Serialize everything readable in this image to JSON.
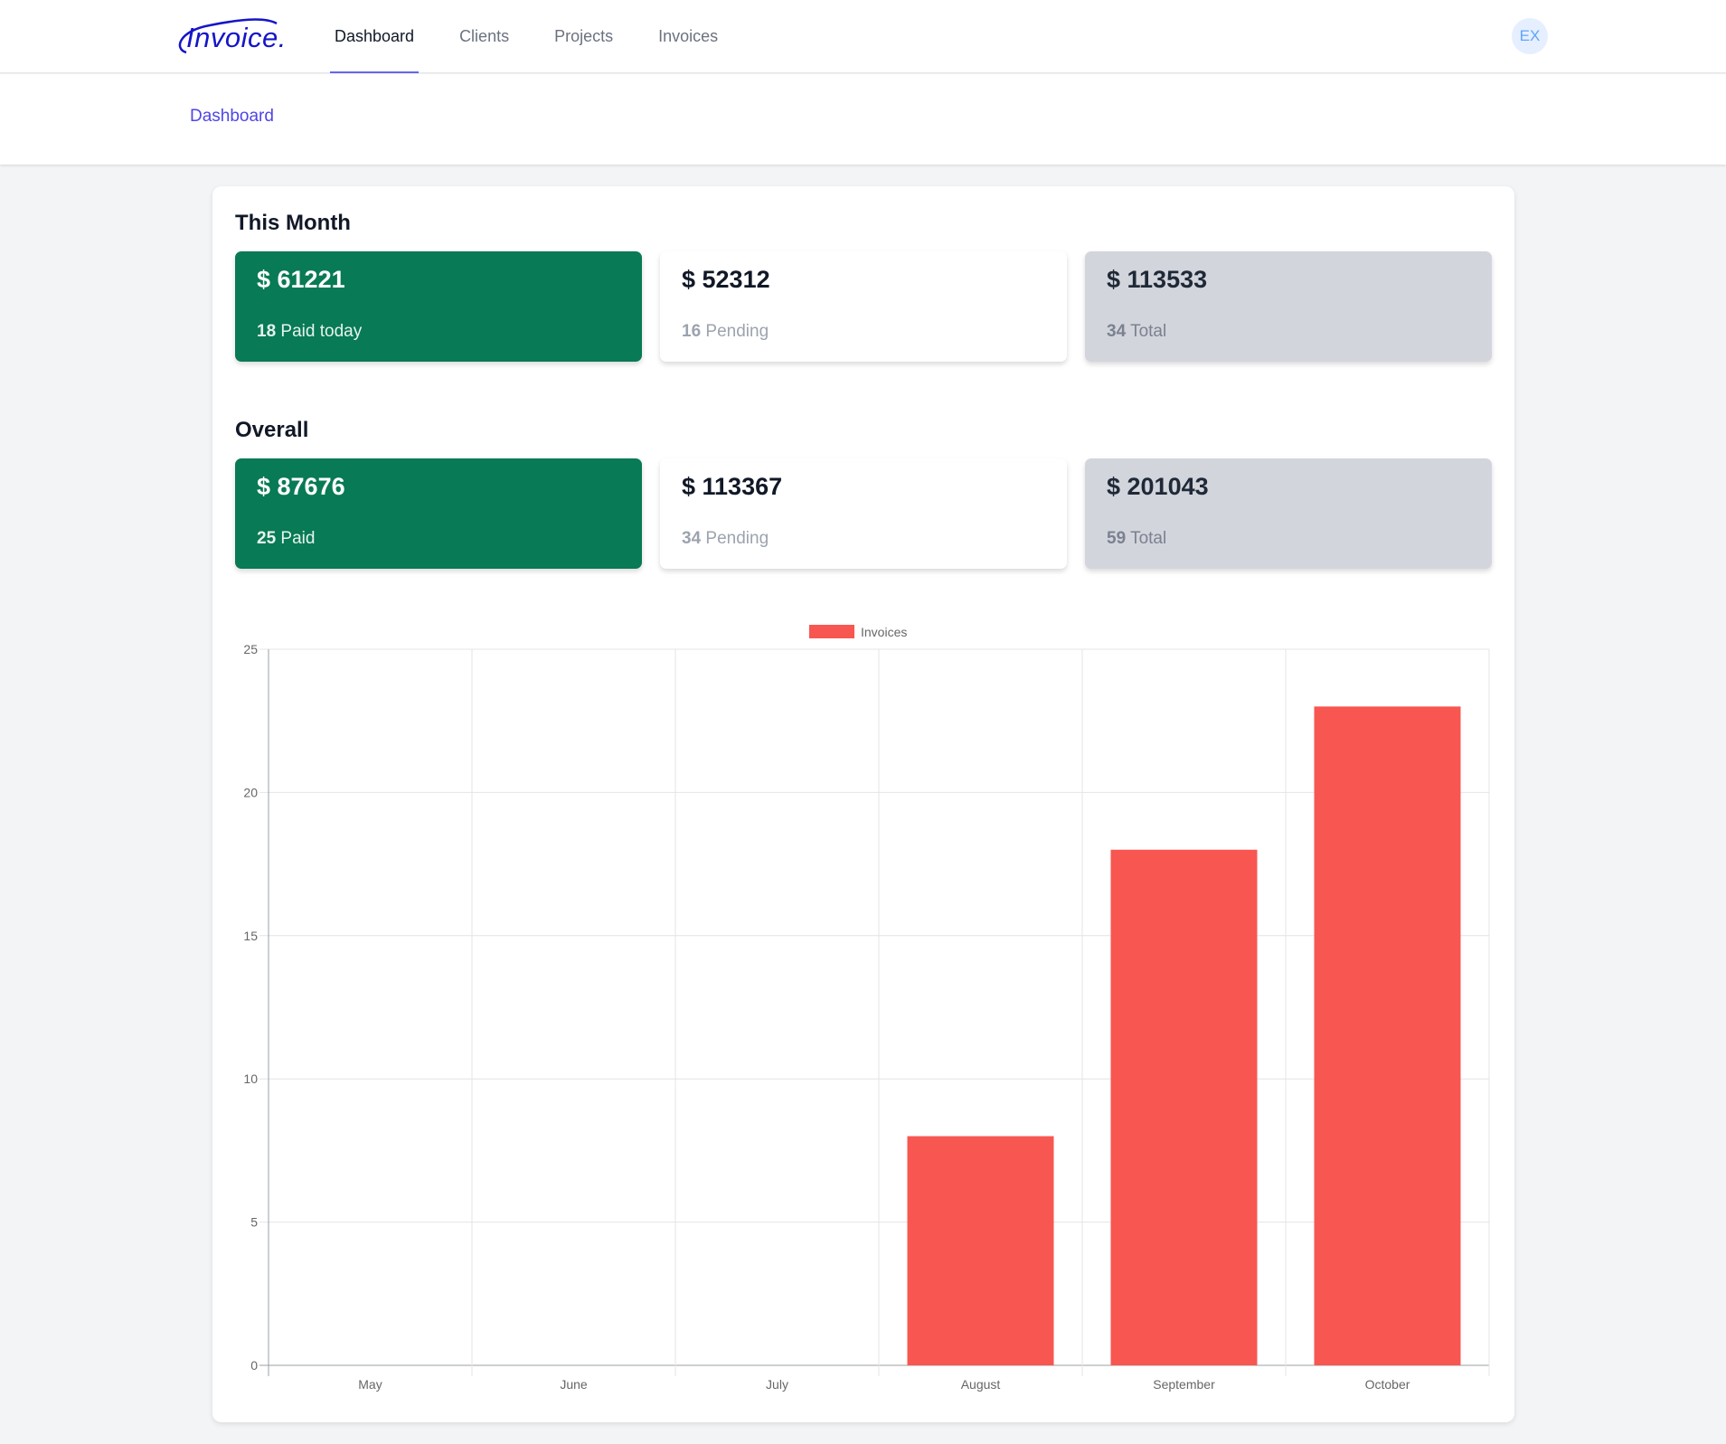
{
  "app": {
    "logo_text": "Invoice.",
    "nav": [
      {
        "label": "Dashboard",
        "active": true
      },
      {
        "label": "Clients",
        "active": false
      },
      {
        "label": "Projects",
        "active": false
      },
      {
        "label": "Invoices",
        "active": false
      }
    ],
    "avatar_initials": "EX"
  },
  "header": {
    "breadcrumb": "Dashboard"
  },
  "this_month": {
    "title": "This Month",
    "stats": [
      {
        "amount": "$ 61221",
        "count": "18",
        "label": "Paid today",
        "style": "green"
      },
      {
        "amount": "$ 52312",
        "count": "16",
        "label": "Pending",
        "style": "white"
      },
      {
        "amount": "$ 113533",
        "count": "34",
        "label": "Total",
        "style": "gray"
      }
    ]
  },
  "overall": {
    "title": "Overall",
    "stats": [
      {
        "amount": "$ 87676",
        "count": "25",
        "label": "Paid",
        "style": "green"
      },
      {
        "amount": "$ 113367",
        "count": "34",
        "label": "Pending",
        "style": "white"
      },
      {
        "amount": "$ 201043",
        "count": "59",
        "label": "Total",
        "style": "gray"
      }
    ]
  },
  "colors": {
    "green": "#087a55",
    "bar": "#f85650",
    "accent": "#4f46e5"
  },
  "chart_data": {
    "type": "bar",
    "categories": [
      "May",
      "June",
      "July",
      "August",
      "September",
      "October"
    ],
    "series": [
      {
        "name": "Invoices",
        "values": [
          0,
          0,
          0,
          8,
          18,
          23
        ],
        "color": "#f85650"
      }
    ],
    "ylim": [
      0,
      25
    ],
    "yticks": [
      0,
      5,
      10,
      15,
      20,
      25
    ],
    "legend": "top-center",
    "grid": true,
    "title": "",
    "xlabel": "",
    "ylabel": ""
  }
}
